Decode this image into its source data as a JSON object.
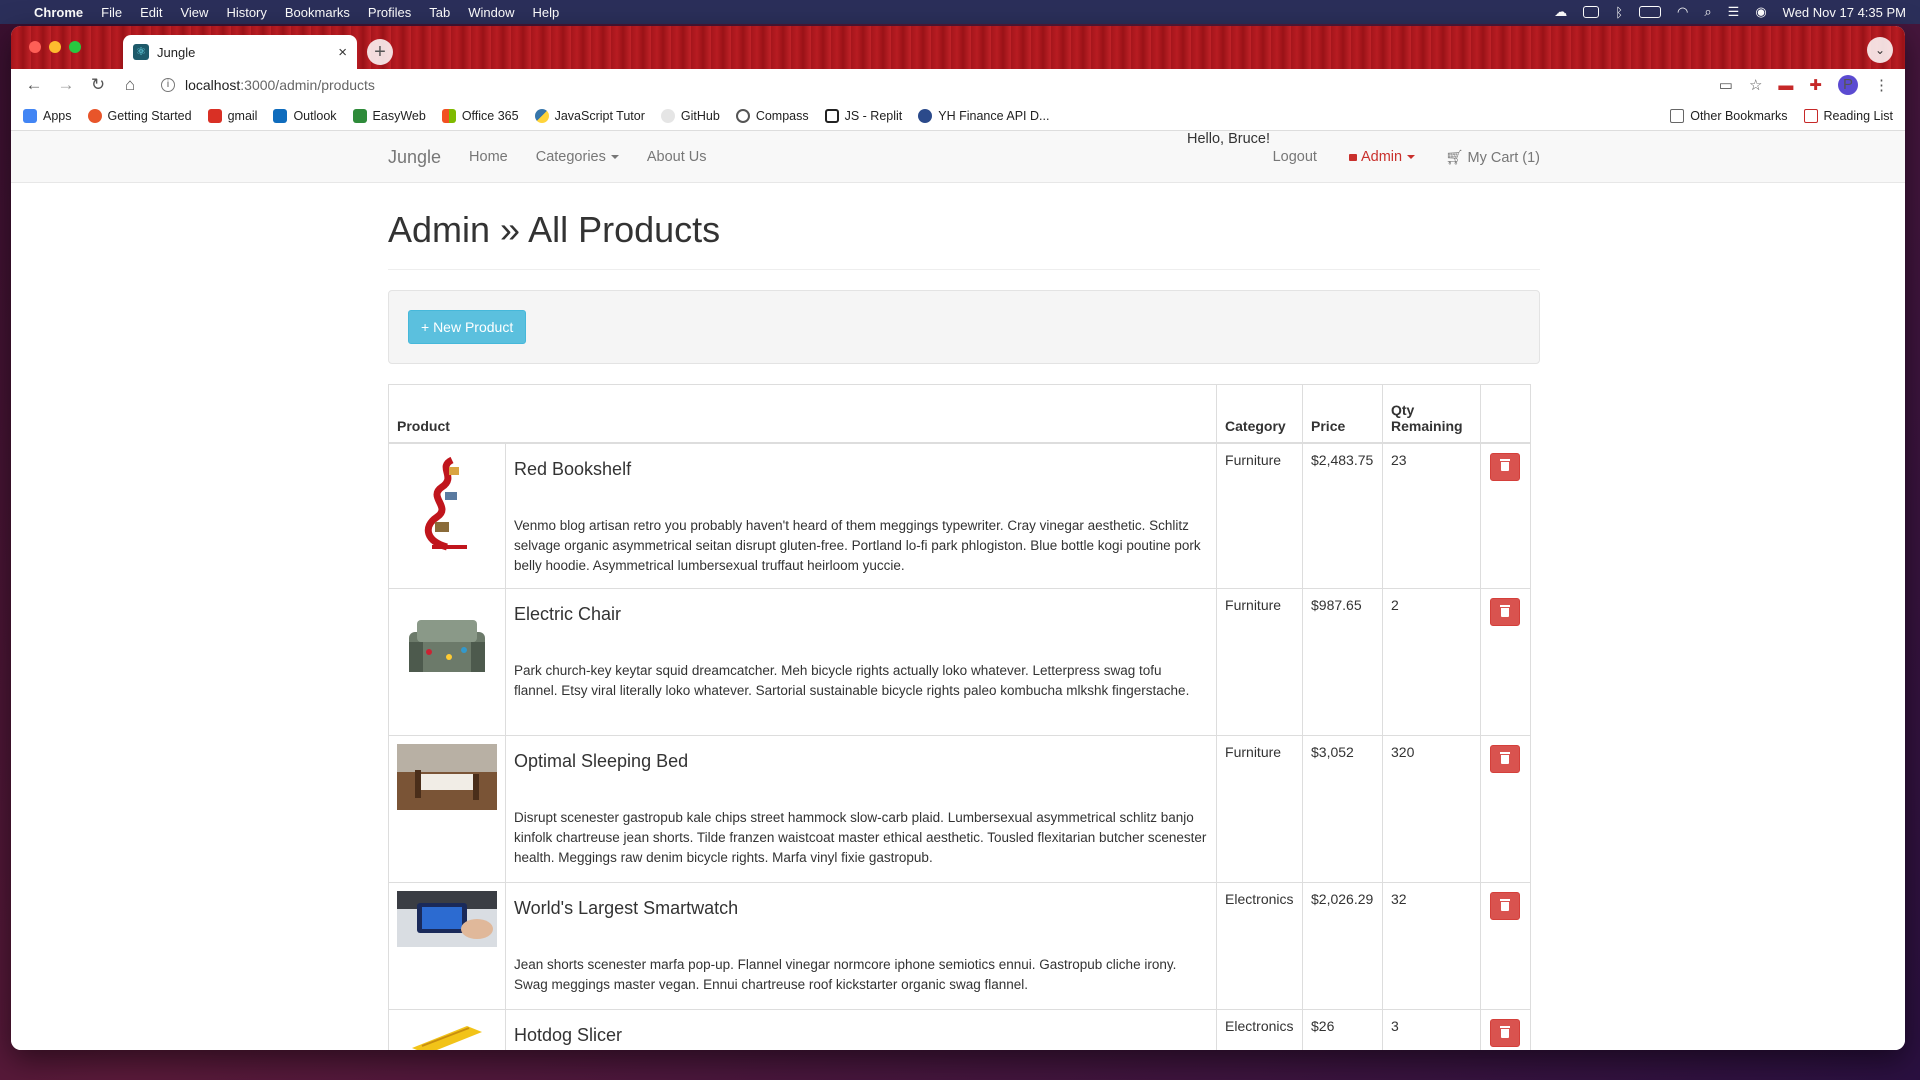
{
  "menubar": {
    "app": "Chrome",
    "items": [
      "File",
      "Edit",
      "View",
      "History",
      "Bookmarks",
      "Profiles",
      "Tab",
      "Window",
      "Help"
    ],
    "clock": "Wed Nov 17  4:35 PM"
  },
  "browser": {
    "tab_title": "Jungle",
    "url_host": "localhost",
    "url_path": ":3000/admin/products",
    "bookmarks": [
      {
        "label": "Apps",
        "color": "#4285f4"
      },
      {
        "label": "Getting Started",
        "color": "#e8552a"
      },
      {
        "label": "gmail",
        "color": "#d93025"
      },
      {
        "label": "Outlook",
        "color": "#0f6cbd"
      },
      {
        "label": "EasyWeb",
        "color": "#2e8b3a"
      },
      {
        "label": "Office 365",
        "color": "#f25022"
      },
      {
        "label": "JavaScript Tutor",
        "color": "#3776ab"
      },
      {
        "label": "GitHub",
        "color": "#333333"
      },
      {
        "label": "Compass",
        "color": "#555555"
      },
      {
        "label": "JS - Replit",
        "color": "#222222"
      },
      {
        "label": "YH Finance API D...",
        "color": "#2b4a8b"
      }
    ],
    "bookmarks_right": [
      {
        "label": "Other Bookmarks"
      },
      {
        "label": "Reading List"
      }
    ]
  },
  "navbar": {
    "brand": "Jungle",
    "links": [
      "Home",
      "Categories",
      "About Us"
    ],
    "greeting": "Hello, Bruce!",
    "logout": "Logout",
    "admin": "Admin",
    "cart": "My Cart (1)"
  },
  "page": {
    "title": "Admin » All Products",
    "new_product": "+ New Product"
  },
  "table": {
    "headers": {
      "product": "Product",
      "category": "Category",
      "price": "Price",
      "qty": "Qty Remaining"
    },
    "rows": [
      {
        "name": "Red Bookshelf",
        "description": "Venmo blog artisan retro you probably haven't heard of them meggings typewriter. Cray vinegar aesthetic. Schlitz selvage organic asymmetrical seitan disrupt gluten-free. Portland lo-fi park phlogiston. Blue bottle kogi poutine pork belly hoodie. Asymmetrical lumbersexual truffaut heirloom yuccie.",
        "category": "Furniture",
        "price": "$2,483.75",
        "qty": "23",
        "thumb": "bookshelf"
      },
      {
        "name": "Electric Chair",
        "description": "Park church-key keytar squid dreamcatcher. Meh bicycle rights actually loko whatever. Letterpress swag tofu flannel. Etsy viral literally loko whatever. Sartorial sustainable bicycle rights paleo kombucha mlkshk fingerstache.",
        "category": "Furniture",
        "price": "$987.65",
        "qty": "2",
        "thumb": "chair"
      },
      {
        "name": "Optimal Sleeping Bed",
        "description": "Disrupt scenester gastropub kale chips street hammock slow-carb plaid. Lumbersexual asymmetrical schlitz banjo kinfolk chartreuse jean shorts. Tilde franzen waistcoat master ethical aesthetic. Tousled flexitarian butcher scenester health. Meggings raw denim bicycle rights. Marfa vinyl fixie gastropub.",
        "category": "Furniture",
        "price": "$3,052",
        "qty": "320",
        "thumb": "bed"
      },
      {
        "name": "World's Largest Smartwatch",
        "description": "Jean shorts scenester marfa pop-up. Flannel vinegar normcore iphone semiotics ennui. Gastropub cliche irony. Swag meggings master vegan. Ennui chartreuse roof kickstarter organic swag flannel.",
        "category": "Electronics",
        "price": "$2,026.29",
        "qty": "32",
        "thumb": "watch"
      },
      {
        "name": "Hotdog Slicer",
        "description": "",
        "category": "Electronics",
        "price": "$26",
        "qty": "3",
        "thumb": "slicer"
      }
    ]
  }
}
